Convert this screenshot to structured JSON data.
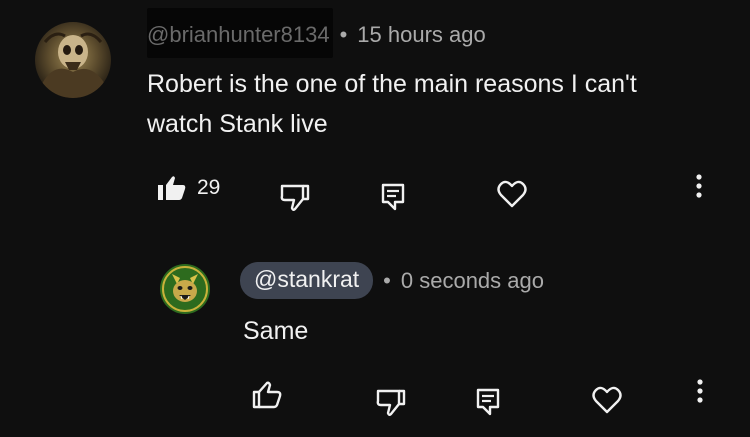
{
  "comment": {
    "author_handle": "@brianhunter8134",
    "timestamp": "15 hours ago",
    "separator": "•",
    "text_line1": "Robert is the one of the main reasons I can't",
    "text_line2": "watch Stank live",
    "like_count": "29",
    "like_state": "liked"
  },
  "reply": {
    "author_handle": "@stankrat",
    "timestamp": "0 seconds ago",
    "separator": "•",
    "text": "Same",
    "like_state": "not-liked"
  },
  "icons": {
    "like": "thumbs-up-icon",
    "dislike": "thumbs-down-icon",
    "reply": "reply-icon",
    "heart": "heart-icon",
    "more": "more-vertical-icon"
  },
  "colors": {
    "background": "#0f0f0f",
    "text": "#f1f1f1",
    "secondary_text": "#aaaaaa",
    "handle_chip": "#3e4451"
  }
}
